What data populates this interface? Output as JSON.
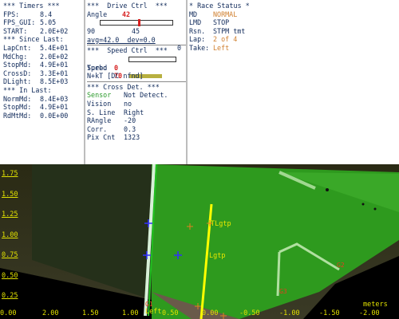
{
  "timers": {
    "header": "*** Timers ***",
    "fps_label": "FPS:",
    "fps_value": "8.4",
    "fpsgui_label": "FPS_GUI:",
    "fpsgui_value": "5.05",
    "start_label": "START:",
    "start_value": "2.0E+02",
    "since_last_header": "*** Since Last:",
    "lapcnt_label": "LapCnt:",
    "lapcnt_value": "5.4E+01",
    "mdchg_label": "MdChg:",
    "mdchg_value": "2.0E+02",
    "stopmd_label": "StopMd:",
    "stopmd_value": "4.9E+01",
    "crossd_label": "CrossD:",
    "crossd_value": "3.3E+01",
    "dlight_label": "DLight:",
    "dlight_value": "8.5E+03",
    "in_last_header": "*** In Last:",
    "normmd_label": "NormMd:",
    "normmd_value": "8.4E+03",
    "stopmd2_label": "StopMd:",
    "stopmd2_value": "4.9E+01",
    "rdmtmd_label": "RdMtMd:",
    "rdmtmd_value": "0.0E+00"
  },
  "drive": {
    "header": "***  Drive Ctrl  ***",
    "angle_label": "Angle",
    "angle_value": "42",
    "slider_min": "90",
    "slider_max": "0",
    "slider_center": "45",
    "slider_level": 0.533,
    "avg_text": "avg=42.0  dev=0.0",
    "speed_header": "***  Speed Ctrl  ***",
    "speed_label": "Speed",
    "speed_value": "70",
    "speed_level": 0.7,
    "turbo_label": "Turbo",
    "turbo_value": "0",
    "nkt_text": "N+kT [DC nfnd]",
    "cross_header": "*** Cross Det. ***",
    "sensor_label": "Sensor",
    "sensor_value": "Not Detect.",
    "vision_label": "Vision",
    "vision_value": "no",
    "sline_label": "S. Line",
    "sline_value": "Right",
    "rangle_label": "RAngle",
    "rangle_value": "-20",
    "corr_label": "Corr.",
    "corr_value": "0.3",
    "pixcnt_label": "Pix Cnt",
    "pixcnt_value": "1323"
  },
  "race": {
    "header": "* Race Status *",
    "md_label": "MD",
    "md_value": "NORMAL",
    "lmd_label": "LMD",
    "lmd_value": "STOP",
    "rsn_label": "Rsn.",
    "rsn_value": "STPM tmt",
    "lap_label": "Lap:",
    "lap_value": "2 of 4",
    "take_label": "Take:",
    "take_value": "Left"
  },
  "camera": {
    "y_ticks": [
      "1.75",
      "1.50",
      "1.25",
      "1.00",
      "0.75",
      "0.50",
      "0.25"
    ],
    "x_ticks": [
      "2.00",
      "1.50",
      "1.00",
      "0.50",
      "0.00",
      "-0.50",
      "-1.00",
      "-1.50",
      "-2.00"
    ],
    "x_origin": "0.00",
    "units": "meters",
    "label_tlgtp": "TLgtp",
    "label_lgtp": "Lgtp",
    "label_left": "Left",
    "label_g1": "G1",
    "label_g2": "G2",
    "label_g3": "G3"
  },
  "colors": {
    "accent_red": "#d62020",
    "status_orange": "#d08030",
    "sensor_green": "#2a9a2a",
    "overlay_yellow": "#e0e000",
    "track_green": "#2e9a1e"
  }
}
